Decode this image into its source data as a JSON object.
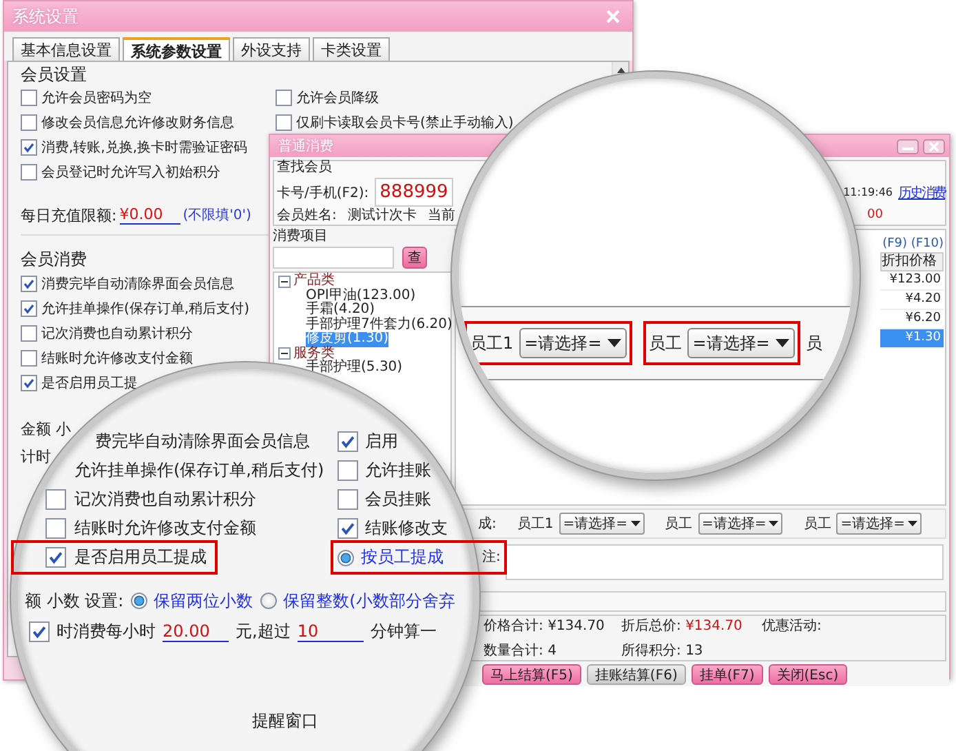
{
  "settings_window": {
    "title": "系统设置",
    "tabs": [
      {
        "label": "基本信息设置",
        "selected": false
      },
      {
        "label": "系统参数设置",
        "selected": true
      },
      {
        "label": "外设支持",
        "selected": false
      },
      {
        "label": "卡类设置",
        "selected": false
      }
    ],
    "member_settings": {
      "title": "会员设置",
      "left": [
        {
          "label": "允许会员密码为空",
          "checked": false
        },
        {
          "label": "修改会员信息允许修改财务信息",
          "checked": false
        },
        {
          "label": "消费,转账,兑换,换卡时需验证密码",
          "checked": true
        },
        {
          "label": "会员登记时允许写入初始积分",
          "checked": false
        }
      ],
      "right": [
        {
          "label": "允许会员降级",
          "checked": false
        },
        {
          "label": "仅刷卡读取会员卡号(禁止手动输入)",
          "checked": false
        }
      ]
    },
    "daily_limit": {
      "label": "每日充值限额:",
      "value": "¥0.00",
      "hint": "(不限填'0')"
    },
    "member_consumption": {
      "title": "会员消费",
      "items": [
        {
          "label": "消费完毕自动清除界面会员信息",
          "checked": true
        },
        {
          "label": "允许挂单操作(保存订单,稍后支付)",
          "checked": true
        },
        {
          "label": "记次消费也自动累计积分",
          "checked": false
        },
        {
          "label": "结账时允许修改支付金额",
          "checked": false
        },
        {
          "label": "是否启用员工提",
          "checked": true
        }
      ]
    },
    "amount_label": "金额 小",
    "timing_label": "计时"
  },
  "consume_window": {
    "title": "普通消费",
    "member_lookup": {
      "title": "查找会员",
      "card_label": "卡号/手机(F2):",
      "card_value": "888999",
      "name_label": "会员姓名:",
      "name_value": "测试计次卡",
      "level_label": "当前",
      "time": "11:19:46",
      "history_link": "历史消费",
      "amount_partial": "00"
    },
    "items_panel": {
      "title": "消费项目",
      "search_button": "查",
      "tree": [
        {
          "label": "产品类",
          "expanded": true,
          "children": [
            {
              "label": "OPI甲油(123.00)",
              "selected": false
            },
            {
              "label": "手霜(4.20)",
              "selected": false
            },
            {
              "label": "手部护理7件套力(6.20)",
              "selected": false
            },
            {
              "label": "修皮剪(1.30)",
              "selected": true
            }
          ]
        },
        {
          "label": "服务类",
          "expanded": true,
          "children": [
            {
              "label": "手部护理(5.30)",
              "selected": false
            }
          ]
        }
      ]
    },
    "order_list": {
      "shortcut_hint": "(F9) (F10)",
      "column": "折扣价格",
      "rows": [
        {
          "price": "¥123.00",
          "selected": false
        },
        {
          "price": "¥4.20",
          "selected": false
        },
        {
          "price": "¥6.20",
          "selected": false
        },
        {
          "price": "¥1.30",
          "selected": true
        }
      ]
    },
    "commission": {
      "label": "成:",
      "staff": [
        {
          "label": "员工1",
          "value": "=请选择="
        },
        {
          "label": "员工",
          "value": "=请选择="
        },
        {
          "label": "员工",
          "value": "=请选择="
        }
      ]
    },
    "remark_label": "注:",
    "totals": [
      {
        "label": "价格合计:",
        "value": "¥134.70",
        "emphasis": false
      },
      {
        "label": "折后总价:",
        "value": "¥134.70",
        "emphasis": true
      },
      {
        "label": "优惠活动:"
      },
      {
        "label": "数量合计:",
        "value": "4",
        "emphasis": false
      },
      {
        "label": "所得积分:",
        "value": "13",
        "emphasis": false
      }
    ],
    "buttons": [
      {
        "label": "马上结算(F5)",
        "disabled": false
      },
      {
        "label": "挂账结算(F6)",
        "disabled": true
      },
      {
        "label": "挂单(F7)",
        "disabled": false
      },
      {
        "label": "关闭(Esc)",
        "disabled": false
      }
    ]
  },
  "magnifier_staff": {
    "fields": [
      {
        "label": "员工1",
        "value": "=请选择=",
        "highlighted": true
      },
      {
        "label": "员工",
        "value": "=请选择=",
        "highlighted": true
      }
    ],
    "edge_text": "员"
  },
  "magnifier_settings": {
    "left": [
      {
        "kind": "text",
        "label": "费完毕自动清除界面会员信息",
        "highlighted": false
      },
      {
        "kind": "text",
        "label": "允许挂单操作(保存订单,稍后支付)",
        "highlighted": false
      },
      {
        "kind": "checkbox",
        "label": "记次消费也自动累计积分",
        "checked": false,
        "highlighted": false
      },
      {
        "kind": "checkbox",
        "label": "结账时允许修改支付金额",
        "checked": false,
        "highlighted": false
      },
      {
        "kind": "checkbox",
        "label": "是否启用员工提成",
        "checked": true,
        "highlighted": true
      }
    ],
    "right": [
      {
        "kind": "checkbox",
        "label": "启用",
        "checked": true,
        "highlighted": false
      },
      {
        "kind": "checkbox",
        "label": "允许挂账",
        "checked": false,
        "highlighted": false
      },
      {
        "kind": "checkbox",
        "label": "会员挂账",
        "checked": false,
        "highlighted": false
      },
      {
        "kind": "checkbox",
        "label": "结账修改支",
        "checked": true,
        "highlighted": false
      },
      {
        "kind": "radio",
        "label": "按员工提成",
        "checked": true,
        "highlighted": true
      }
    ],
    "decimal": {
      "label": "额 小数 设置:",
      "options": [
        {
          "label": "保留两位小数",
          "selected": true
        },
        {
          "label": "保留整数(小数部分舍弃",
          "selected": false
        }
      ]
    },
    "timing": {
      "checked": true,
      "label": "时消费每小时",
      "rate": "20.00",
      "unit": "元,超过",
      "minutes": "10",
      "suffix": "分钟算一"
    },
    "reminder": "提醒窗口"
  }
}
